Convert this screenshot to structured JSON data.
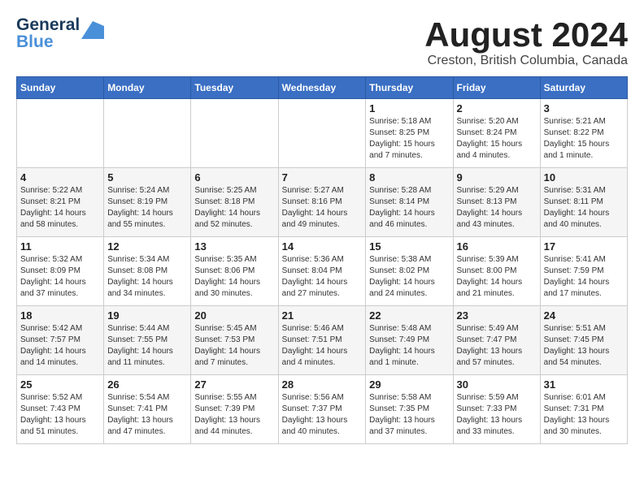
{
  "logo": {
    "line1": "General",
    "line2": "Blue"
  },
  "title": "August 2024",
  "location": "Creston, British Columbia, Canada",
  "days_of_week": [
    "Sunday",
    "Monday",
    "Tuesday",
    "Wednesday",
    "Thursday",
    "Friday",
    "Saturday"
  ],
  "weeks": [
    [
      {
        "day": "",
        "info": ""
      },
      {
        "day": "",
        "info": ""
      },
      {
        "day": "",
        "info": ""
      },
      {
        "day": "",
        "info": ""
      },
      {
        "day": "1",
        "info": "Sunrise: 5:18 AM\nSunset: 8:25 PM\nDaylight: 15 hours\nand 7 minutes."
      },
      {
        "day": "2",
        "info": "Sunrise: 5:20 AM\nSunset: 8:24 PM\nDaylight: 15 hours\nand 4 minutes."
      },
      {
        "day": "3",
        "info": "Sunrise: 5:21 AM\nSunset: 8:22 PM\nDaylight: 15 hours\nand 1 minute."
      }
    ],
    [
      {
        "day": "4",
        "info": "Sunrise: 5:22 AM\nSunset: 8:21 PM\nDaylight: 14 hours\nand 58 minutes."
      },
      {
        "day": "5",
        "info": "Sunrise: 5:24 AM\nSunset: 8:19 PM\nDaylight: 14 hours\nand 55 minutes."
      },
      {
        "day": "6",
        "info": "Sunrise: 5:25 AM\nSunset: 8:18 PM\nDaylight: 14 hours\nand 52 minutes."
      },
      {
        "day": "7",
        "info": "Sunrise: 5:27 AM\nSunset: 8:16 PM\nDaylight: 14 hours\nand 49 minutes."
      },
      {
        "day": "8",
        "info": "Sunrise: 5:28 AM\nSunset: 8:14 PM\nDaylight: 14 hours\nand 46 minutes."
      },
      {
        "day": "9",
        "info": "Sunrise: 5:29 AM\nSunset: 8:13 PM\nDaylight: 14 hours\nand 43 minutes."
      },
      {
        "day": "10",
        "info": "Sunrise: 5:31 AM\nSunset: 8:11 PM\nDaylight: 14 hours\nand 40 minutes."
      }
    ],
    [
      {
        "day": "11",
        "info": "Sunrise: 5:32 AM\nSunset: 8:09 PM\nDaylight: 14 hours\nand 37 minutes."
      },
      {
        "day": "12",
        "info": "Sunrise: 5:34 AM\nSunset: 8:08 PM\nDaylight: 14 hours\nand 34 minutes."
      },
      {
        "day": "13",
        "info": "Sunrise: 5:35 AM\nSunset: 8:06 PM\nDaylight: 14 hours\nand 30 minutes."
      },
      {
        "day": "14",
        "info": "Sunrise: 5:36 AM\nSunset: 8:04 PM\nDaylight: 14 hours\nand 27 minutes."
      },
      {
        "day": "15",
        "info": "Sunrise: 5:38 AM\nSunset: 8:02 PM\nDaylight: 14 hours\nand 24 minutes."
      },
      {
        "day": "16",
        "info": "Sunrise: 5:39 AM\nSunset: 8:00 PM\nDaylight: 14 hours\nand 21 minutes."
      },
      {
        "day": "17",
        "info": "Sunrise: 5:41 AM\nSunset: 7:59 PM\nDaylight: 14 hours\nand 17 minutes."
      }
    ],
    [
      {
        "day": "18",
        "info": "Sunrise: 5:42 AM\nSunset: 7:57 PM\nDaylight: 14 hours\nand 14 minutes."
      },
      {
        "day": "19",
        "info": "Sunrise: 5:44 AM\nSunset: 7:55 PM\nDaylight: 14 hours\nand 11 minutes."
      },
      {
        "day": "20",
        "info": "Sunrise: 5:45 AM\nSunset: 7:53 PM\nDaylight: 14 hours\nand 7 minutes."
      },
      {
        "day": "21",
        "info": "Sunrise: 5:46 AM\nSunset: 7:51 PM\nDaylight: 14 hours\nand 4 minutes."
      },
      {
        "day": "22",
        "info": "Sunrise: 5:48 AM\nSunset: 7:49 PM\nDaylight: 14 hours\nand 1 minute."
      },
      {
        "day": "23",
        "info": "Sunrise: 5:49 AM\nSunset: 7:47 PM\nDaylight: 13 hours\nand 57 minutes."
      },
      {
        "day": "24",
        "info": "Sunrise: 5:51 AM\nSunset: 7:45 PM\nDaylight: 13 hours\nand 54 minutes."
      }
    ],
    [
      {
        "day": "25",
        "info": "Sunrise: 5:52 AM\nSunset: 7:43 PM\nDaylight: 13 hours\nand 51 minutes."
      },
      {
        "day": "26",
        "info": "Sunrise: 5:54 AM\nSunset: 7:41 PM\nDaylight: 13 hours\nand 47 minutes."
      },
      {
        "day": "27",
        "info": "Sunrise: 5:55 AM\nSunset: 7:39 PM\nDaylight: 13 hours\nand 44 minutes."
      },
      {
        "day": "28",
        "info": "Sunrise: 5:56 AM\nSunset: 7:37 PM\nDaylight: 13 hours\nand 40 minutes."
      },
      {
        "day": "29",
        "info": "Sunrise: 5:58 AM\nSunset: 7:35 PM\nDaylight: 13 hours\nand 37 minutes."
      },
      {
        "day": "30",
        "info": "Sunrise: 5:59 AM\nSunset: 7:33 PM\nDaylight: 13 hours\nand 33 minutes."
      },
      {
        "day": "31",
        "info": "Sunrise: 6:01 AM\nSunset: 7:31 PM\nDaylight: 13 hours\nand 30 minutes."
      }
    ]
  ]
}
